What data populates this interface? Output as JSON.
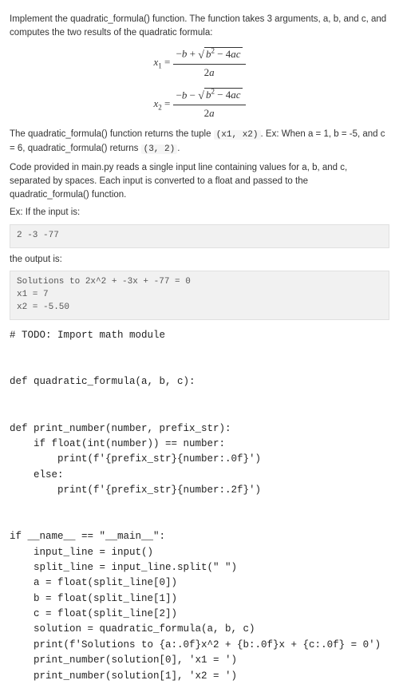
{
  "intro": "Implement the quadratic_formula() function. The function takes 3 arguments, a, b, and c, and computes the two results of the quadratic formula:",
  "formula1": {
    "lhs": "x",
    "lhs_sub": "1",
    "op": "+"
  },
  "formula2": {
    "lhs": "x",
    "lhs_sub": "2",
    "op": "−"
  },
  "returns_text_a": "The quadratic_formula() function returns the tuple ",
  "returns_tuple": "(x1, x2)",
  "returns_text_b": ". Ex: When a = 1, b = -5, and c = 6, quadratic_formula() returns ",
  "returns_result": "(3, 2)",
  "returns_text_c": ".",
  "desc2": "Code provided in main.py reads a single input line containing values for a, b, and c, separated by spaces. Each input is converted to a float and passed to the quadratic_formula() function.",
  "ex_input_label": "Ex: If the input is:",
  "ex_input": "2 -3 -77",
  "ex_output_label": "the output is:",
  "ex_output": "Solutions to 2x^2 + -3x + -77 = 0\nx1 = 7\nx2 = -5.50",
  "source": "# TODO: Import math module\n\n\ndef quadratic_formula(a, b, c):\n\n\ndef print_number(number, prefix_str):\n    if float(int(number)) == number:\n        print(f'{prefix_str}{number:.0f}')\n    else:\n        print(f'{prefix_str}{number:.2f}')\n\n\nif __name__ == \"__main__\":\n    input_line = input()\n    split_line = input_line.split(\" \")\n    a = float(split_line[0])\n    b = float(split_line[1])\n    c = float(split_line[2])\n    solution = quadratic_formula(a, b, c)\n    print(f'Solutions to {a:.0f}x^2 + {b:.0f}x + {c:.0f} = 0')\n    print_number(solution[0], 'x1 = ')\n    print_number(solution[1], 'x2 = ')"
}
